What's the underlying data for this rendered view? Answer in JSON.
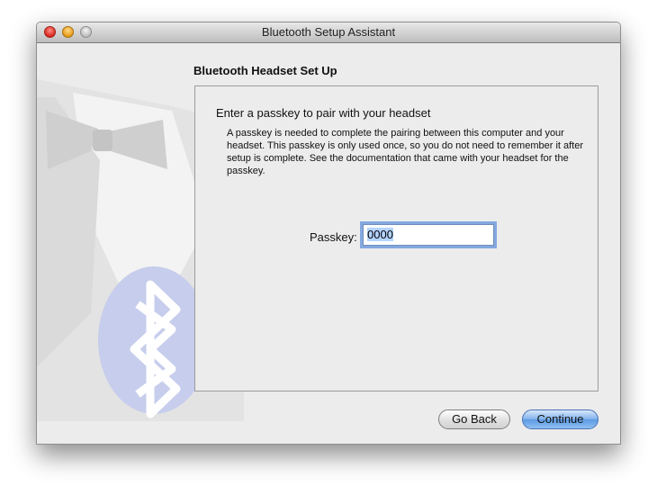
{
  "window": {
    "title": "Bluetooth Setup Assistant"
  },
  "page": {
    "heading": "Bluetooth Headset Set Up",
    "instruction": "Enter a passkey to pair with your headset",
    "description": "A passkey is needed to complete the pairing between this computer and your headset. This passkey is only used once, so you do not need to remember it after setup is complete. See the documentation that came with your headset for the passkey."
  },
  "passkey": {
    "label": "Passkey:",
    "value": "0000"
  },
  "buttons": {
    "back": "Go Back",
    "continue": "Continue"
  },
  "colors": {
    "accent": "#84a8df",
    "default_button": "#6aa4e8"
  },
  "icons": {
    "art": "bluetooth-tuxedo-icon"
  }
}
